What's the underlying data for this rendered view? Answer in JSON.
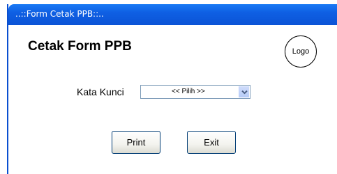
{
  "window": {
    "title": "..::Form Cetak PPB::.."
  },
  "form": {
    "heading": "Cetak Form PPB",
    "logo_text": "Logo",
    "keyword_label": "Kata Kunci",
    "keyword_select": {
      "selected": "<< Pilih >>"
    },
    "buttons": {
      "print_label": "Print",
      "exit_label": "Exit"
    }
  },
  "colors": {
    "titlebar": "#0b54d6",
    "accent_border": "#003c74"
  },
  "icons": {
    "select_arrow": "chevron-down-icon"
  }
}
